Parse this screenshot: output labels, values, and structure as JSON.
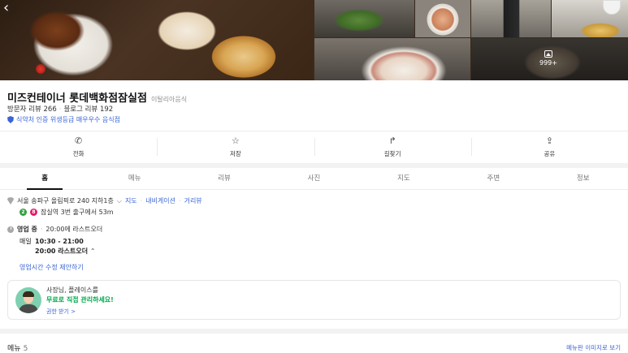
{
  "photos": {
    "count_label": "999+"
  },
  "place": {
    "name": "미즈컨테이너 롯데백화점잠실점",
    "category": "이탈리아음식",
    "visitor_reviews": "방문자 리뷰 266",
    "blog_reviews": "블로그 리뷰 192",
    "hygiene_badge": "식약처 인증 위생등급 매우우수 음식점"
  },
  "actions": [
    {
      "label": "전화",
      "icon": "phone-icon"
    },
    {
      "label": "저장",
      "icon": "star-icon"
    },
    {
      "label": "길찾기",
      "icon": "directions-icon"
    },
    {
      "label": "공유",
      "icon": "share-icon"
    }
  ],
  "tabs": [
    "홈",
    "메뉴",
    "리뷰",
    "사진",
    "지도",
    "주변",
    "정보"
  ],
  "active_tab": "홈",
  "info": {
    "address": "서울 송파구 올림픽로 240 지하1층",
    "address_links": [
      "지도",
      "내비게이션",
      "거리뷰"
    ],
    "subway_lines": [
      "2",
      "8"
    ],
    "subway_text": "잠실역 3번 출구에서 53m",
    "status": "영업 중",
    "last_order_note": "20:00에 라스트오더",
    "hours_day": "매일",
    "hours_time": "10:30 - 21:00",
    "hours_last_order": "20:00 라스트오더",
    "suggest_edit": "영업시간 수정 제안하기"
  },
  "owner_card": {
    "title": "사장님, 플레이스를",
    "headline": "무료로 직접 관리하세요!",
    "link": "권한 받기 >"
  },
  "menu_section": {
    "title": "메뉴",
    "count": "5",
    "image_link": "메뉴판 이미지로 보기"
  },
  "colors": {
    "link_blue": "#3a64d6",
    "green_accent": "#03a94d",
    "line2": "#33a23d",
    "line8": "#e6186c"
  }
}
